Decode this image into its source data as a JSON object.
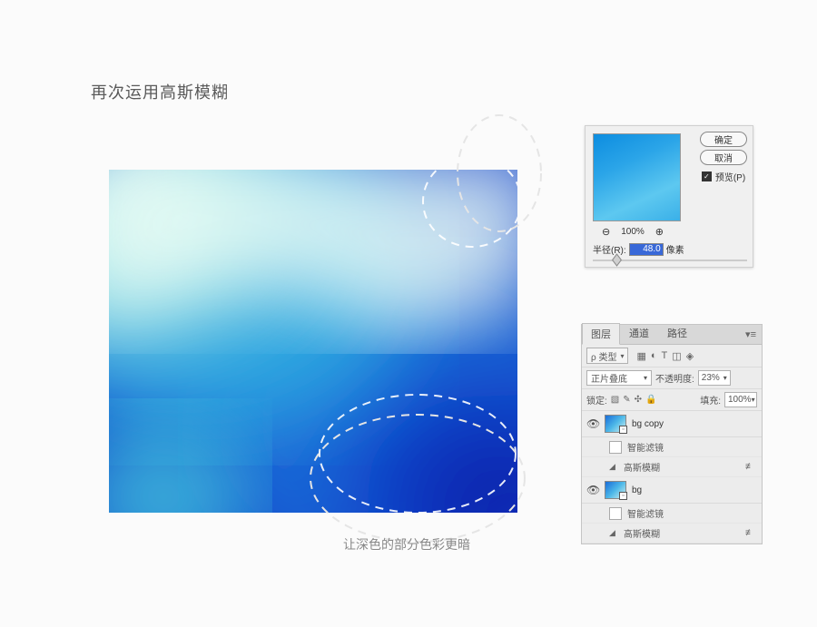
{
  "title": "再次运用高斯模糊",
  "caption": "让深色的部分色彩更暗",
  "blur_dialog": {
    "ok": "确定",
    "cancel": "取消",
    "preview_label": "预览(P)",
    "zoom_percent": "100%",
    "radius_label": "半径(R):",
    "radius_value": "48.0",
    "radius_unit": "像素"
  },
  "layers_panel": {
    "tabs": {
      "layers": "图层",
      "channels": "通道",
      "paths": "路径"
    },
    "filter_type": "ρ 类型",
    "blend_mode": "正片叠底",
    "opacity_label": "不透明度:",
    "opacity_value": "23%",
    "lock_label": "锁定:",
    "fill_label": "填充:",
    "fill_value": "100%",
    "layers": [
      {
        "name": "bg copy",
        "smart_filter_label": "智能滤镜",
        "filter_name": "高斯模糊"
      },
      {
        "name": "bg",
        "smart_filter_label": "智能滤镜",
        "filter_name": "高斯模糊"
      }
    ]
  }
}
